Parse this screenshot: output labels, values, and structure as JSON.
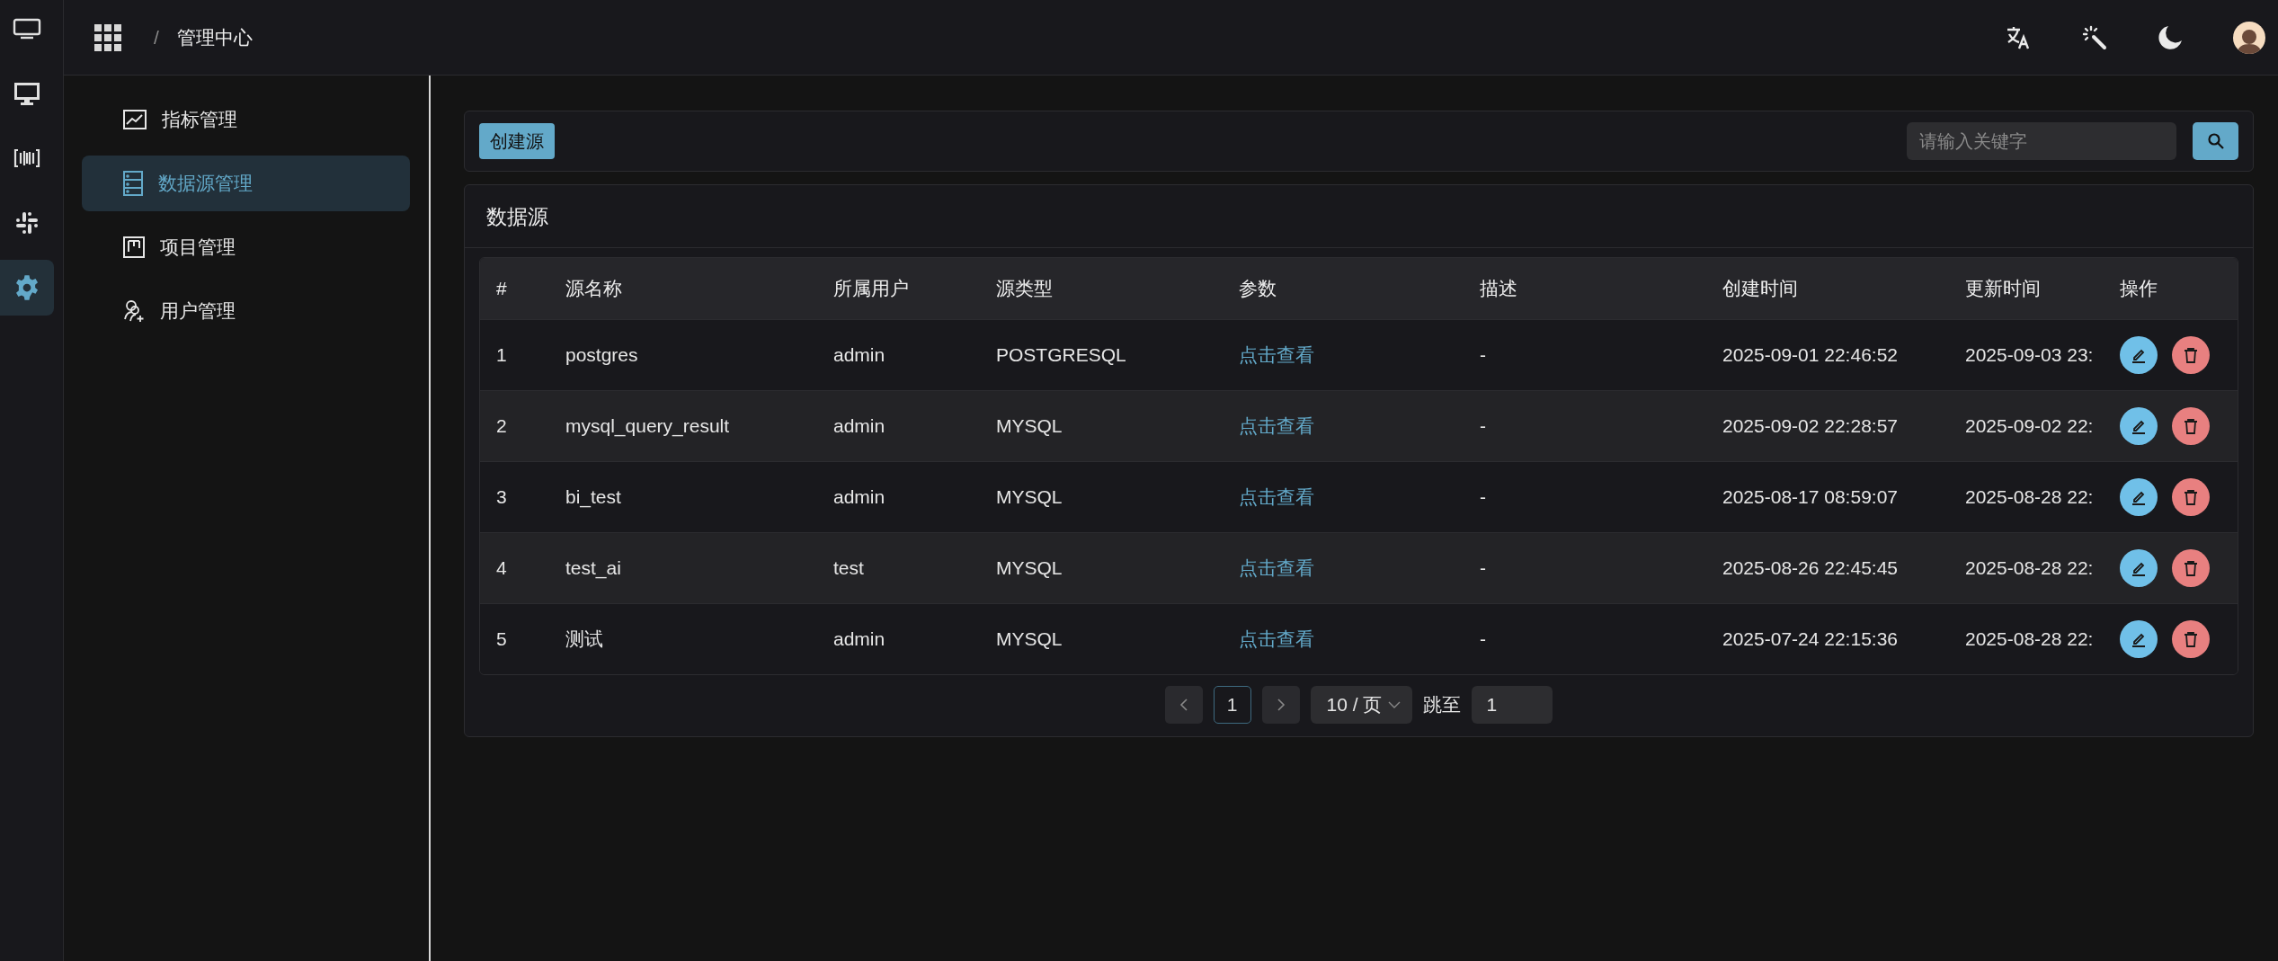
{
  "rail": [
    {
      "kind": "monitor",
      "selected": false
    },
    {
      "kind": "desktop",
      "selected": false
    },
    {
      "kind": "bars",
      "selected": false
    },
    {
      "kind": "hash",
      "selected": false
    },
    {
      "kind": "gear",
      "selected": true
    }
  ],
  "header": {
    "separator": "/",
    "breadcrumb": "管理中心"
  },
  "sidebar": {
    "items": [
      {
        "kind": "chart",
        "label": "指标管理",
        "selected": false
      },
      {
        "kind": "database",
        "label": "数据源管理",
        "selected": true
      },
      {
        "kind": "board",
        "label": "项目管理",
        "selected": false
      },
      {
        "kind": "users",
        "label": "用户管理",
        "selected": false
      }
    ]
  },
  "toolbar": {
    "create_button": "创建源",
    "search": {
      "placeholder": "请输入关键字"
    }
  },
  "panel": {
    "title": "数据源"
  },
  "table": {
    "columns": [
      "#",
      "源名称",
      "所属用户",
      "源类型",
      "参数",
      "描述",
      "创建时间",
      "更新时间",
      "操作"
    ],
    "rows": [
      {
        "index": "1",
        "name": "postgres",
        "owner": "admin",
        "type": "POSTGRESQL",
        "params": "点击查看",
        "description": "-",
        "created": "2025-09-01 22:46:52",
        "updated": "2025-09-03 23:"
      },
      {
        "index": "2",
        "name": "mysql_query_result",
        "owner": "admin",
        "type": "MYSQL",
        "params": "点击查看",
        "description": "-",
        "created": "2025-09-02 22:28:57",
        "updated": "2025-09-02 22:"
      },
      {
        "index": "3",
        "name": "bi_test",
        "owner": "admin",
        "type": "MYSQL",
        "params": "点击查看",
        "description": "-",
        "created": "2025-08-17 08:59:07",
        "updated": "2025-08-28 22:"
      },
      {
        "index": "4",
        "name": "test_ai",
        "owner": "test",
        "type": "MYSQL",
        "params": "点击查看",
        "description": "-",
        "created": "2025-08-26 22:45:45",
        "updated": "2025-08-28 22:"
      },
      {
        "index": "5",
        "name": "测试",
        "owner": "admin",
        "type": "MYSQL",
        "params": "点击查看",
        "description": "-",
        "created": "2025-07-24 22:15:36",
        "updated": "2025-08-28 22:"
      }
    ]
  },
  "pagination": {
    "pages": [
      {
        "label": "1",
        "selected": true
      }
    ],
    "page_size": "10 / 页",
    "jump_label": "跳至",
    "jump_value": "1"
  }
}
